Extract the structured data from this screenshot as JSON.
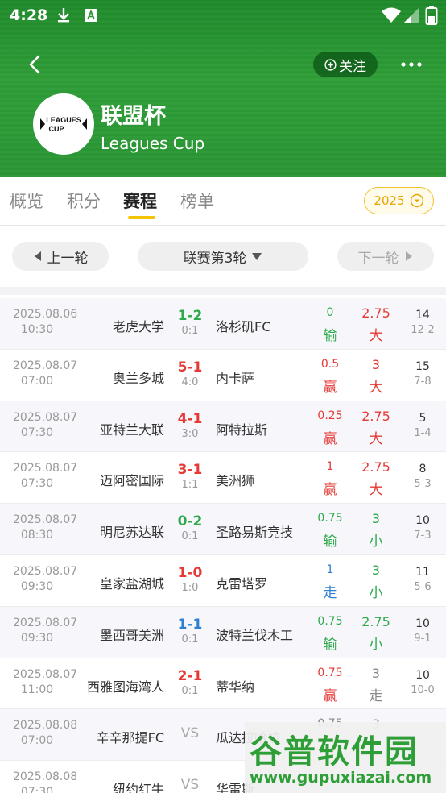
{
  "status_bar": {
    "time": "4:28"
  },
  "header": {
    "follow_label": "关注",
    "league_name": "联盟杯",
    "league_name_en": "Leagues Cup",
    "logo_text_1": "LEAGUES",
    "logo_text_2": "CUP"
  },
  "tabs": [
    {
      "label": "概览",
      "active": false
    },
    {
      "label": "积分",
      "active": false
    },
    {
      "label": "赛程",
      "active": true
    },
    {
      "label": "榜单",
      "active": false
    }
  ],
  "year_filter": "2025",
  "round_nav": {
    "prev": "上一轮",
    "current": "联赛第3轮",
    "next": "下一轮"
  },
  "matches": [
    {
      "date": "2025.08.06",
      "time": "10:30",
      "home": "老虎大学",
      "score": "1-2",
      "score_color": "green",
      "half": "0:1",
      "away": "洛杉矶FC",
      "handicap": "0",
      "handicap_result": "输",
      "handicap_color": "green",
      "ou": "2.75",
      "ou_result": "大",
      "ou_color": "red",
      "rank_home": "14",
      "rank_away": "12-2"
    },
    {
      "date": "2025.08.07",
      "time": "07:00",
      "home": "奥兰多城",
      "score": "5-1",
      "score_color": "red",
      "half": "4:0",
      "away": "内卡萨",
      "handicap": "0.5",
      "handicap_result": "赢",
      "handicap_color": "red",
      "ou": "3",
      "ou_result": "大",
      "ou_color": "red",
      "rank_home": "15",
      "rank_away": "7-8"
    },
    {
      "date": "2025.08.07",
      "time": "07:30",
      "home": "亚特兰大联",
      "score": "4-1",
      "score_color": "red",
      "half": "3:0",
      "away": "阿特拉斯",
      "handicap": "0.25",
      "handicap_result": "赢",
      "handicap_color": "red",
      "ou": "2.75",
      "ou_result": "大",
      "ou_color": "red",
      "rank_home": "5",
      "rank_away": "1-4"
    },
    {
      "date": "2025.08.07",
      "time": "07:30",
      "home": "迈阿密国际",
      "score": "3-1",
      "score_color": "red",
      "half": "1:1",
      "away": "美洲狮",
      "handicap": "1",
      "handicap_result": "赢",
      "handicap_color": "red",
      "ou": "2.75",
      "ou_result": "大",
      "ou_color": "red",
      "rank_home": "8",
      "rank_away": "5-3"
    },
    {
      "date": "2025.08.07",
      "time": "08:30",
      "home": "明尼苏达联",
      "score": "0-2",
      "score_color": "green",
      "half": "0:1",
      "away": "圣路易斯竞技",
      "handicap": "0.75",
      "handicap_result": "输",
      "handicap_color": "green",
      "ou": "3",
      "ou_result": "小",
      "ou_color": "green",
      "rank_home": "10",
      "rank_away": "7-3"
    },
    {
      "date": "2025.08.07",
      "time": "09:30",
      "home": "皇家盐湖城",
      "score": "1-0",
      "score_color": "red",
      "half": "1:0",
      "away": "克雷塔罗",
      "handicap": "1",
      "handicap_result": "走",
      "handicap_color": "blue",
      "ou": "3",
      "ou_result": "小",
      "ou_color": "green",
      "rank_home": "11",
      "rank_away": "5-6"
    },
    {
      "date": "2025.08.07",
      "time": "09:30",
      "home": "墨西哥美洲",
      "score": "1-1",
      "score_color": "blue",
      "half": "0:1",
      "away": "波特兰伐木工",
      "handicap": "0.75",
      "handicap_result": "输",
      "handicap_color": "green",
      "ou": "2.75",
      "ou_result": "小",
      "ou_color": "green",
      "rank_home": "10",
      "rank_away": "9-1"
    },
    {
      "date": "2025.08.07",
      "time": "11:00",
      "home": "西雅图海湾人",
      "score": "2-1",
      "score_color": "red",
      "half": "0:1",
      "away": "蒂华纳",
      "handicap": "0.75",
      "handicap_result": "赢",
      "handicap_color": "red",
      "ou": "3",
      "ou_result": "走",
      "ou_color": "gray",
      "rank_home": "10",
      "rank_away": "10-0"
    },
    {
      "date": "2025.08.08",
      "time": "07:00",
      "home": "辛辛那提FC",
      "score": "VS",
      "score_color": "vs",
      "half": "",
      "away": "瓜达拉哈拉",
      "handicap": "0.75",
      "handicap_result": "",
      "handicap_color": "gray",
      "ou": "3",
      "ou_result": "",
      "ou_color": "gray",
      "rank_home": "",
      "rank_away": ""
    },
    {
      "date": "2025.08.08",
      "time": "07:30",
      "home": "纽约红牛",
      "score": "VS",
      "score_color": "vs",
      "half": "",
      "away": "华雷斯",
      "handicap": "",
      "handicap_result": "",
      "handicap_color": "gray",
      "ou": "",
      "ou_result": "",
      "ou_color": "gray",
      "rank_home": "",
      "rank_away": ""
    }
  ],
  "watermark": {
    "text": "谷普软件园",
    "url": "www.gupuxiazai.com"
  },
  "colors": {
    "header_green": "#2e9e37",
    "accent_yellow": "#f5c400",
    "win_red": "#e53935",
    "lose_green": "#2eaa4c",
    "draw_blue": "#2d7fd2"
  }
}
